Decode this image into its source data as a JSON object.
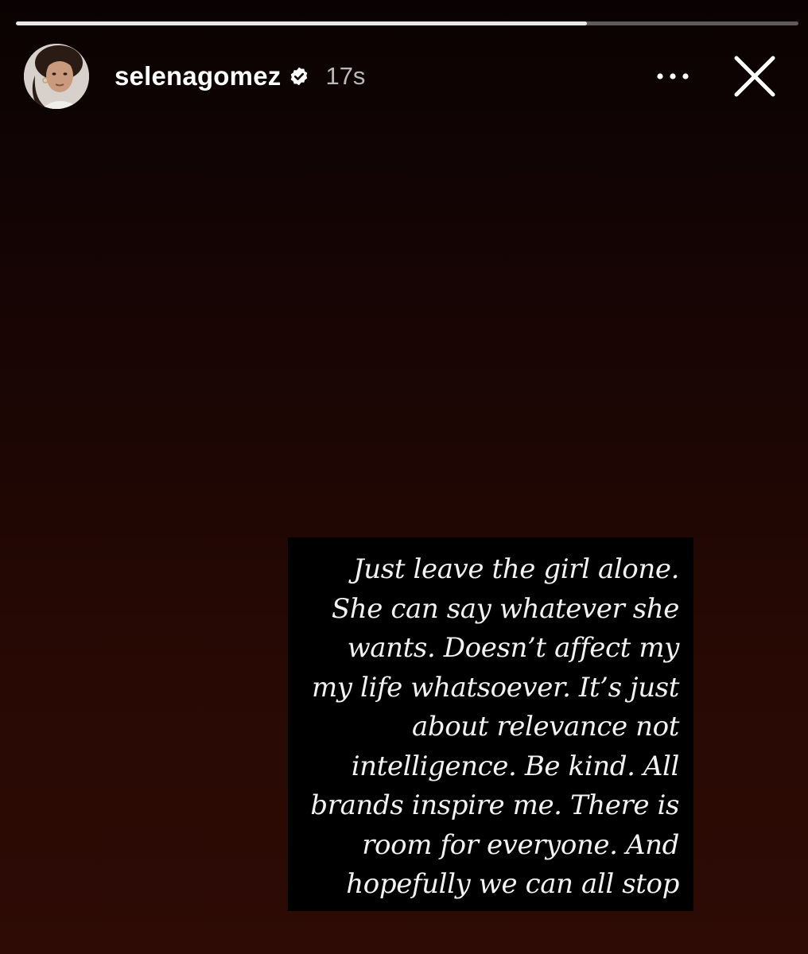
{
  "story": {
    "progress_fraction": 0.73,
    "username": "selenagomez",
    "verified": true,
    "timestamp": "17s",
    "caption_lines": [
      "Just leave the girl alone.",
      "She can say whatever she",
      "wants. Doesn’t affect my",
      "my life whatsoever. It’s just",
      "about relevance not",
      "intelligence. Be kind. All",
      "brands inspire me. There is",
      "room for everyone.  And",
      "hopefully we can all stop"
    ]
  },
  "icons": {
    "more": "more-horizontal-icon",
    "close": "close-icon",
    "verified": "verified-badge-icon"
  },
  "colors": {
    "background_top": "#0a0202",
    "background_bottom": "#2e0b05",
    "text_card": "#000000",
    "text": "#f2f2f2"
  }
}
